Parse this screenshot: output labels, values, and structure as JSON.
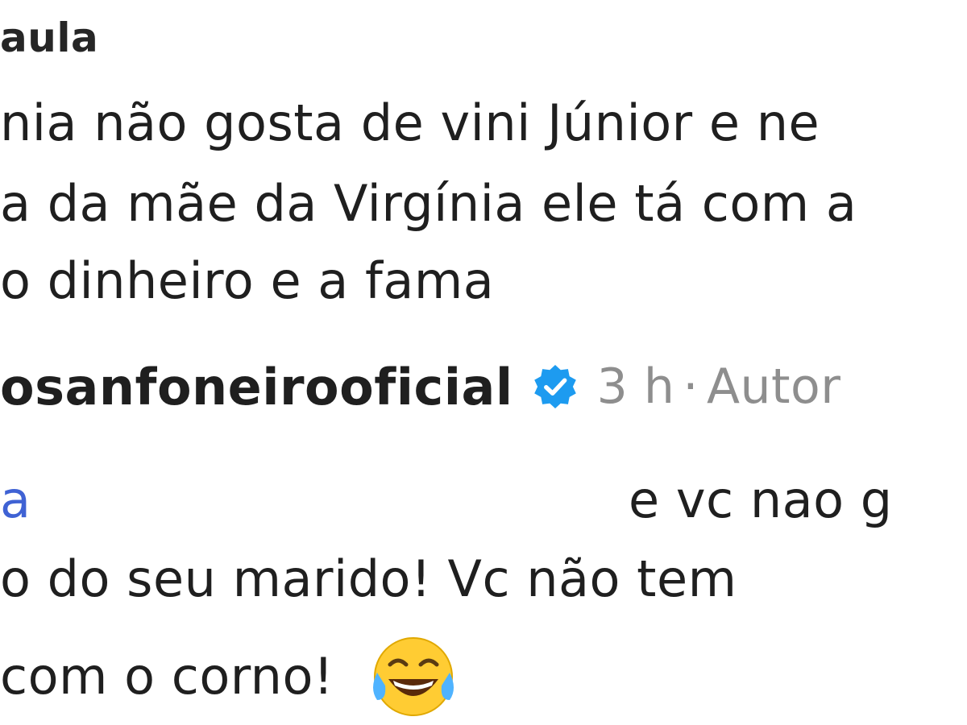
{
  "top_comment": {
    "username": "aula",
    "lines": [
      "nia não gosta de vini Júnior e ne",
      "a da mãe da Virgínia ele tá com a",
      "o dinheiro e a fama"
    ]
  },
  "reply": {
    "username": "osanfoneirooficial",
    "verified_icon": "verified-badge-icon",
    "time": "3 h",
    "separator": "·",
    "author_label": "Autor",
    "mention": "a",
    "first_line_tail": "e vc nao g",
    "line2": "o do seu marido! Vc não tem",
    "line3": "com o corno!",
    "emoji_icon": "tears-of-joy-emoji-icon"
  },
  "colors": {
    "text": "#1f1f1f",
    "meta": "#8e8e8e",
    "mention": "#3f62d4",
    "verified": "#1d9bf0"
  }
}
